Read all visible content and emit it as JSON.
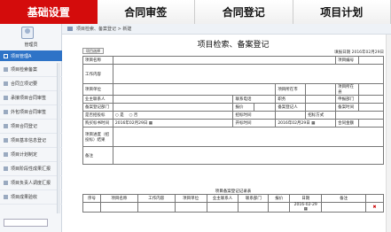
{
  "top_tabs": [
    {
      "label": "基础设置",
      "active": true
    },
    {
      "label": "合同审签",
      "active": false
    },
    {
      "label": "合同登记",
      "active": false
    },
    {
      "label": "项目计划",
      "active": false
    }
  ],
  "user": {
    "name": "管理员"
  },
  "sidebar": {
    "section": "项目管理A",
    "items": [
      {
        "label": "项目检索备案"
      },
      {
        "label": "合同立项记要"
      },
      {
        "label": "承接项目合同审签"
      },
      {
        "label": "外包项目合同审签"
      },
      {
        "label": "项目合同登记"
      },
      {
        "label": "项目基本信息登记"
      },
      {
        "label": "项目计划制定"
      },
      {
        "label": "项目阶段性成果汇报"
      },
      {
        "label": "项目负责人调度汇报"
      },
      {
        "label": "项目成果验收"
      }
    ]
  },
  "breadcrumb": "项目检索、备案登记 > 新建",
  "form": {
    "title": "项目检索、备案登记",
    "small_button": "项目选择",
    "date_label": "填报日期",
    "date_value": "2016年02月29日",
    "labels": {
      "project_name": "项目名称",
      "contract_no": "项目编号",
      "work_content": "工作内容",
      "project_unit": "项目单位",
      "project_location": "项目所在市",
      "project_type": "项目所在县",
      "owner_contact": "业主联系人",
      "contact_person": "联系电话",
      "position": "职务",
      "phone": "申报部门",
      "registered_dept": "备案登记部门",
      "reporter": "报价",
      "filing_person": "备案登记人",
      "filing_date": "备案时间",
      "is_bid": "是否招投标",
      "bid_time": "招标时间",
      "bid_method": "招标方式",
      "open_time": "购买标书时间",
      "open_time2": "开标时间",
      "contract_fee": "合同金额",
      "results": "项目进度（招投标）结果",
      "remark": "备注"
    },
    "radio_yes": "是",
    "radio_no": "否",
    "date_a": "2016年02月29日",
    "date_b": "2016年02月29日",
    "sub_title": "项目备案登记记录表",
    "sub_headers": [
      "序号",
      "项目名称",
      "工作内容",
      "项目单位",
      "业主联系人",
      "联系部门",
      "报价",
      "日期",
      "备注",
      ""
    ],
    "sub_row": {
      "date": "2016-02-29"
    }
  }
}
